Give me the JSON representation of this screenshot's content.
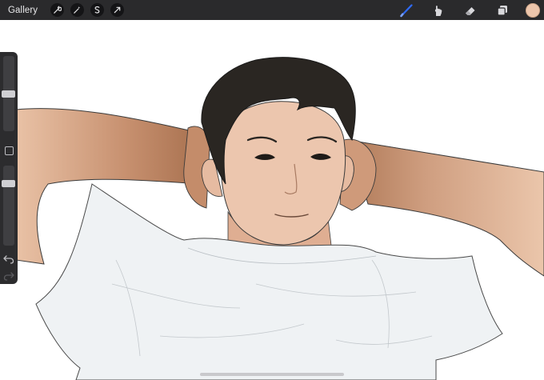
{
  "topbar": {
    "gallery_label": "Gallery",
    "left_tools": [
      "wrench-icon",
      "magic-wand-icon",
      "selection-icon",
      "transform-arrow-icon"
    ],
    "right_tools": [
      "brush-icon",
      "smudge-icon",
      "eraser-icon",
      "layers-icon"
    ],
    "active_tool": "brush-icon",
    "accent_color": "#2f6bff",
    "current_color": "#edc6ac"
  },
  "sidebar": {
    "brush_size_level": 0.5,
    "opacity_level": 0.2,
    "icons": [
      "modify-square-icon",
      "undo-icon",
      "redo-icon"
    ]
  },
  "palette": {
    "bar": "#2a2a2c",
    "skin": "#eac4ad",
    "arm": "#c99779",
    "hair": "#2a2622",
    "shirt": "#eff2f4"
  }
}
